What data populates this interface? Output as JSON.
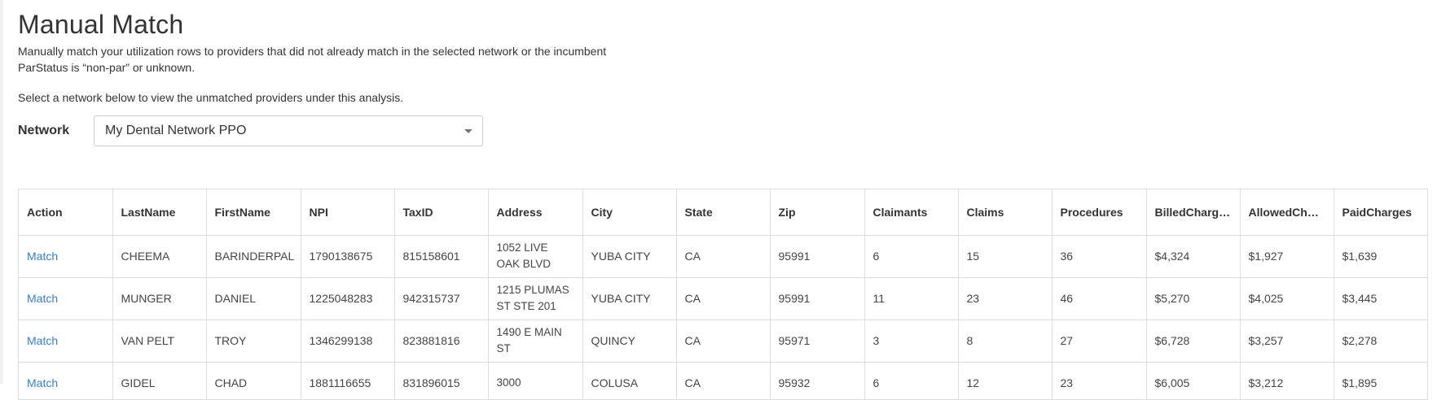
{
  "page": {
    "title": "Manual Match",
    "description_line1": "Manually match your utilization rows to providers that did not already match in the selected network or the incumbent",
    "description_line2": "ParStatus is “non-par” or unknown.",
    "select_hint": "Select a network below to view the unmatched providers under this analysis."
  },
  "network": {
    "label": "Network",
    "selected": "My Dental Network PPO"
  },
  "table": {
    "columns": [
      "Action",
      "LastName",
      "FirstName",
      "NPI",
      "TaxID",
      "Address",
      "City",
      "State",
      "Zip",
      "Claimants",
      "Claims",
      "Procedures",
      "BilledCharges",
      "AllowedChar…",
      "PaidCharges"
    ],
    "rows": [
      {
        "action": "Match",
        "last": "CHEEMA",
        "first": "BARINDERPAL",
        "npi": "1790138675",
        "taxid": "815158601",
        "address": "1052 LIVE OAK BLVD",
        "city": "YUBA CITY",
        "state": "CA",
        "zip": "95991",
        "claimants": "6",
        "claims": "15",
        "procedures": "36",
        "billed": "$4,324",
        "allowed": "$1,927",
        "paid": "$1,639"
      },
      {
        "action": "Match",
        "last": "MUNGER",
        "first": "DANIEL",
        "npi": "1225048283",
        "taxid": "942315737",
        "address": "1215 PLUMAS ST STE 201",
        "city": "YUBA CITY",
        "state": "CA",
        "zip": "95991",
        "claimants": "11",
        "claims": "23",
        "procedures": "46",
        "billed": "$5,270",
        "allowed": "$4,025",
        "paid": "$3,445"
      },
      {
        "action": "Match",
        "last": "VAN PELT",
        "first": "TROY",
        "npi": "1346299138",
        "taxid": "823881816",
        "address": "1490 E MAIN ST",
        "city": "QUINCY",
        "state": "CA",
        "zip": "95971",
        "claimants": "3",
        "claims": "8",
        "procedures": "27",
        "billed": "$6,728",
        "allowed": "$3,257",
        "paid": "$2,278"
      },
      {
        "action": "Match",
        "last": "GIDEL",
        "first": "CHAD",
        "npi": "1881116655",
        "taxid": "831896015",
        "address": "3000",
        "city": "COLUSA",
        "state": "CA",
        "zip": "95932",
        "claimants": "6",
        "claims": "12",
        "procedures": "23",
        "billed": "$6,005",
        "allowed": "$3,212",
        "paid": "$1,895"
      }
    ]
  },
  "colors": {
    "link": "#3a7fc4",
    "border": "#dddddd",
    "text": "#333333"
  }
}
